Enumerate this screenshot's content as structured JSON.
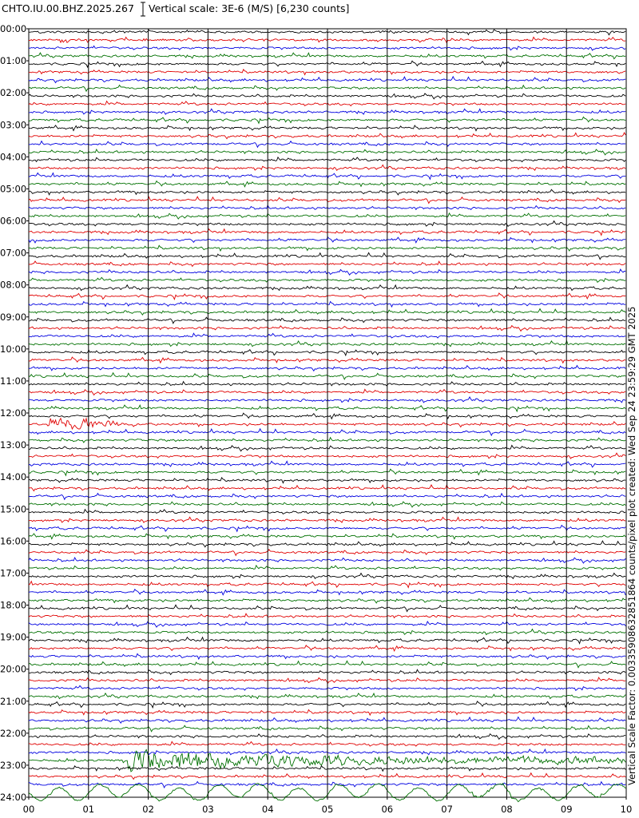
{
  "header": {
    "station": "CHTO.IU.00.BHZ.2025.267",
    "scale_label": "Vertical scale: 3E-6 (M/S) [6,230 counts]"
  },
  "side_note": "Vertical Scale Factor: 0.00335908632851864 counts/pixel plot created: Wed Sep 24 23:59:29 GMT 2025",
  "colors": {
    "cycle": [
      "#000000",
      "#e00000",
      "#0000e0",
      "#007000"
    ],
    "grid": "#000000",
    "background": "#ffffff"
  },
  "chart_data": {
    "type": "line",
    "title": "CHTO.IU.00.BHZ.2025.267",
    "xlabel": "",
    "ylabel": "",
    "xlim": [
      0,
      10
    ],
    "x_ticks": [
      "00",
      "01",
      "02",
      "03",
      "04",
      "05",
      "06",
      "07",
      "08",
      "09",
      "10"
    ],
    "y_tick_labels": [
      "00:00",
      "01:00",
      "02:00",
      "03:00",
      "04:00",
      "05:00",
      "06:00",
      "07:00",
      "08:00",
      "09:00",
      "10:00",
      "11:00",
      "12:00",
      "13:00",
      "14:00",
      "15:00",
      "16:00",
      "17:00",
      "18:00",
      "19:00",
      "20:00",
      "21:00",
      "22:00",
      "23:00",
      "24:00"
    ],
    "traces_per_hour": 4,
    "trace_count": 96,
    "events": [
      {
        "trace": 49,
        "x_start": 0.3,
        "x_end": 1.5,
        "amplitude": "large",
        "color": "#0000e0"
      },
      {
        "trace": 91,
        "x_start": 1.65,
        "x_end": 10,
        "amplitude": "large",
        "color": "#e00000"
      },
      {
        "trace": 95,
        "x_start": 0,
        "x_end": 10,
        "amplitude": "long-period",
        "color": "#007000"
      }
    ]
  }
}
